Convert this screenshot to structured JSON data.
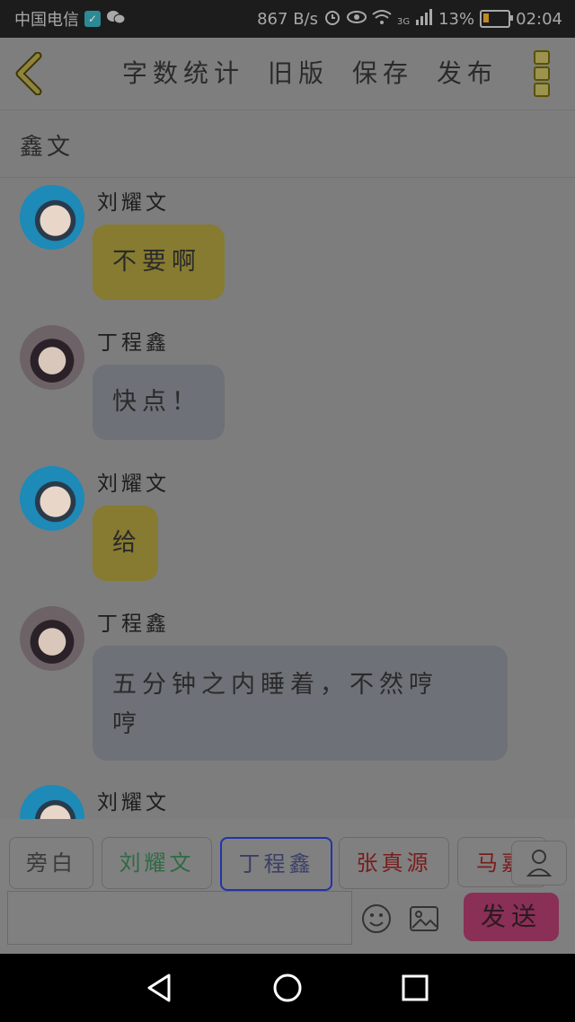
{
  "status_bar": {
    "carrier": "中国电信",
    "net_speed": "867 B/s",
    "network_type": "3G",
    "battery_percent": "13%",
    "time": "02:04"
  },
  "toolbar": {
    "actions": [
      "字数统计",
      "旧版",
      "保存",
      "发布"
    ]
  },
  "title": "鑫文",
  "messages": [
    {
      "sender": "刘耀文",
      "text": "不要啊",
      "style": "yellow"
    },
    {
      "sender": "丁程鑫",
      "text": "快点！",
      "style": "gray"
    },
    {
      "sender": "刘耀文",
      "text": "给",
      "style": "yellow"
    },
    {
      "sender": "丁程鑫",
      "text_line1": "五分钟之内睡着，不然哼",
      "text_line2": "哼",
      "style": "gray"
    },
    {
      "sender": "刘耀文"
    }
  ],
  "characters": [
    {
      "name": "旁白",
      "color": "#3a3a3a"
    },
    {
      "name": "刘耀文",
      "color": "#2f6a45"
    },
    {
      "name": "丁程鑫",
      "color": "#3b3f66",
      "selected": true,
      "border": "#2233aa"
    },
    {
      "name": "张真源",
      "color": "#7a1c1c"
    },
    {
      "name": "马嘉",
      "color": "#7a1c1c"
    }
  ],
  "input": {
    "value": ""
  },
  "send_label": "发送"
}
